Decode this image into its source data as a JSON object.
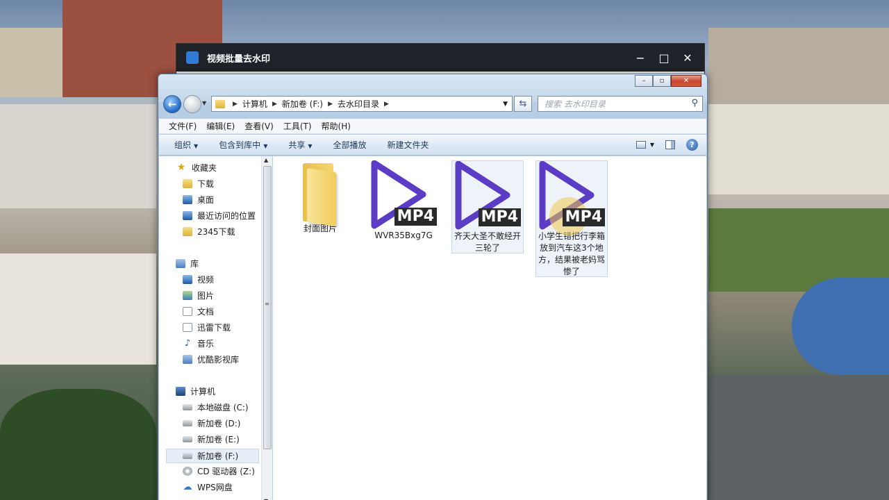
{
  "app": {
    "title": "视频批量去水印",
    "controls": {
      "minimize": "−",
      "maximize": "□",
      "close": "✕"
    }
  },
  "explorer": {
    "titlebar_controls": {
      "minimize": "–",
      "maximize": "▫",
      "close": "✕"
    },
    "address": {
      "crumbs": [
        "计算机",
        "新加卷 (F:)",
        "去水印目录"
      ]
    },
    "search": {
      "placeholder": "搜索 去水印目录"
    },
    "menu": [
      "文件(F)",
      "编辑(E)",
      "查看(V)",
      "工具(T)",
      "帮助(H)"
    ],
    "toolbar": {
      "organize": "组织",
      "include_in_library": "包含到库中",
      "share": "共享",
      "play_all": "全部播放",
      "new_folder": "新建文件夹"
    },
    "nav": {
      "favorites_header": "收藏夹",
      "favorites": [
        "下载",
        "桌面",
        "最近访问的位置",
        "2345下载"
      ],
      "libraries_header": "库",
      "libraries": [
        "视频",
        "图片",
        "文档",
        "迅雷下载",
        "音乐",
        "优酷影视库"
      ],
      "computer_header": "计算机",
      "drives": [
        "本地磁盘 (C:)",
        "新加卷 (D:)",
        "新加卷 (E:)",
        "新加卷 (F:)",
        "CD 驱动器 (Z:)",
        "WPS网盘"
      ]
    },
    "files": [
      {
        "name": "封面图片",
        "type": "folder"
      },
      {
        "name": "WVR35Bxg7G",
        "type": "mp4",
        "badge": "MP4"
      },
      {
        "name": "齐天大圣不敢经开三轮了",
        "type": "mp4",
        "badge": "MP4"
      },
      {
        "name": "小学生错把行李箱放到汽车这3个地方，结果被老妈骂惨了",
        "type": "mp4",
        "badge": "MP4"
      }
    ],
    "colors": {
      "play_icon": "#5b3cc4",
      "badge_bg": "#2a2a2a"
    }
  }
}
